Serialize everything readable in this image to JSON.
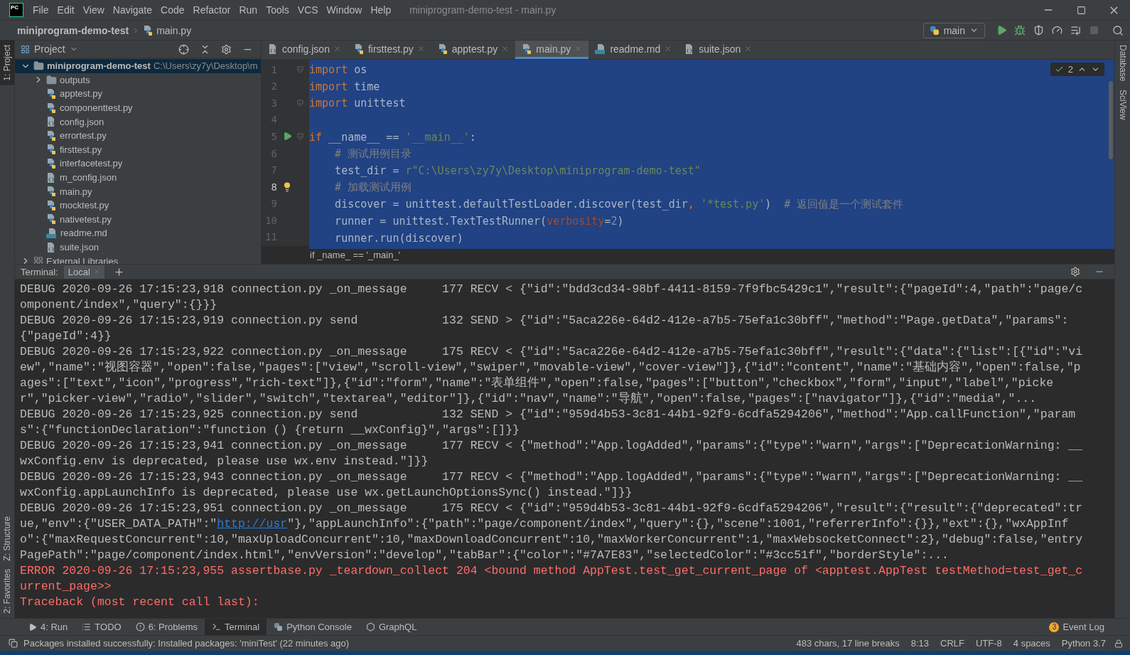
{
  "window": {
    "app_logo": "PC",
    "title": "miniprogram-demo-test - main.py"
  },
  "menu": [
    "File",
    "Edit",
    "View",
    "Navigate",
    "Code",
    "Refactor",
    "Run",
    "Tools",
    "VCS",
    "Window",
    "Help"
  ],
  "breadcrumb": [
    {
      "label": "miniprogram-demo-test",
      "kind": "project"
    },
    {
      "label": "main.py",
      "kind": "python"
    }
  ],
  "run_config": {
    "label": "main"
  },
  "left_stripe_top": [
    {
      "label": "1: Project",
      "selected": true
    }
  ],
  "left_stripe_bottom": [
    {
      "label": "Z: Structure",
      "selected": false
    },
    {
      "label": "2: Favorites",
      "selected": false
    }
  ],
  "right_stripe": [
    {
      "label": "Database"
    },
    {
      "label": "SciView"
    }
  ],
  "project": {
    "title": "Project",
    "root": {
      "label": "miniprogram-demo-test",
      "path": "C:\\Users\\zy7y\\Desktop\\m",
      "expanded": true,
      "children": [
        {
          "label": "outputs",
          "kind": "folder",
          "expanded": false
        },
        {
          "label": "apptest.py",
          "kind": "python"
        },
        {
          "label": "componenttest.py",
          "kind": "python"
        },
        {
          "label": "config.json",
          "kind": "json"
        },
        {
          "label": "errortest.py",
          "kind": "python"
        },
        {
          "label": "firsttest.py",
          "kind": "python"
        },
        {
          "label": "interfacetest.py",
          "kind": "python"
        },
        {
          "label": "m_config.json",
          "kind": "json"
        },
        {
          "label": "main.py",
          "kind": "python"
        },
        {
          "label": "mocktest.py",
          "kind": "python"
        },
        {
          "label": "nativetest.py",
          "kind": "python"
        },
        {
          "label": "readme.md",
          "kind": "markdown"
        },
        {
          "label": "suite.json",
          "kind": "json"
        }
      ]
    },
    "extra": {
      "label": "External Libraries",
      "kind": "library",
      "expanded": false
    }
  },
  "editor_tabs": [
    {
      "label": "config.json",
      "kind": "json",
      "selected": false
    },
    {
      "label": "firsttest.py",
      "kind": "python",
      "selected": false
    },
    {
      "label": "apptest.py",
      "kind": "python",
      "selected": false
    },
    {
      "label": "main.py",
      "kind": "python",
      "selected": true
    },
    {
      "label": "readme.md",
      "kind": "markdown",
      "selected": false
    },
    {
      "label": "suite.json",
      "kind": "json",
      "selected": false
    }
  ],
  "inspection": {
    "count": "2"
  },
  "code": [
    {
      "number": "1",
      "current": false,
      "fold": true,
      "tokens": [
        {
          "kind": "keyword",
          "text": "import"
        },
        {
          "kind": "plain",
          "text": " os"
        }
      ]
    },
    {
      "number": "2",
      "current": false,
      "fold": false,
      "tokens": [
        {
          "kind": "keyword",
          "text": "import"
        },
        {
          "kind": "plain",
          "text": " time"
        }
      ]
    },
    {
      "number": "3",
      "current": false,
      "fold": true,
      "tokens": [
        {
          "kind": "keyword",
          "text": "import"
        },
        {
          "kind": "plain",
          "text": " unittest"
        }
      ]
    },
    {
      "number": "4",
      "current": false,
      "fold": false
    },
    {
      "number": "5",
      "current": false,
      "fold": true,
      "kind": "run",
      "tokens": [
        {
          "kind": "keyword",
          "text": "if"
        },
        {
          "kind": "plain",
          "text": " __name__ == "
        },
        {
          "kind": "string",
          "text": "'__main__'"
        },
        {
          "kind": "plain",
          "text": ":"
        }
      ]
    },
    {
      "number": "6",
      "current": false,
      "fold": false,
      "tokens": [
        {
          "kind": "comment",
          "text": "    # 测试用例目录"
        }
      ]
    },
    {
      "number": "7",
      "current": false,
      "fold": false,
      "tokens": [
        {
          "kind": "plain",
          "text": "    test_dir = "
        },
        {
          "kind": "string",
          "text": "r\"C:\\Users\\zy7y\\Desktop\\miniprogram-demo-test\""
        }
      ]
    },
    {
      "number": "8",
      "current": true,
      "fold": false,
      "kind": "bulb",
      "tokens": [
        {
          "kind": "comment",
          "text": "    # 加载测试用例"
        }
      ]
    },
    {
      "number": "9",
      "current": false,
      "fold": false,
      "tokens": [
        {
          "kind": "plain",
          "text": "    discover = unittest.defaultTestLoader.discover(test_dir"
        },
        {
          "kind": "keyword",
          "text": ","
        },
        {
          "kind": "string",
          "text": " '*test.py'"
        },
        {
          "kind": "plain",
          "text": ")  "
        },
        {
          "kind": "comment",
          "text": "# 返回值是一个测试套件"
        }
      ]
    },
    {
      "number": "10",
      "current": false,
      "fold": false,
      "tokens": [
        {
          "kind": "plain",
          "text": "    runner = unittest.TextTestRunner("
        },
        {
          "kind": "param",
          "text": "verbosity"
        },
        {
          "kind": "plain",
          "text": "="
        },
        {
          "kind": "number",
          "text": "2"
        },
        {
          "kind": "plain",
          "text": ")"
        }
      ]
    },
    {
      "number": "11",
      "current": false,
      "fold": false,
      "tokens": [
        {
          "kind": "plain",
          "text": "    runner.run(discover)"
        }
      ]
    }
  ],
  "editor_breadcrumb": "if _name_ == '_main_'",
  "terminal": {
    "title": "Terminal:",
    "tabs": [
      {
        "label": "Local",
        "selected": true
      }
    ],
    "lines": [
      {
        "kind": "debug",
        "text": "DEBUG 2020-09-26 17:15:23,918 connection.py _on_message     177 RECV < {\"id\":\"bdd3cd34-98bf-4411-8159-7f9fbc5429c1\",\"result\":{\"pageId\":4,\"path\":\"page/component/index\",\"query\":{}}}"
      },
      {
        "kind": "debug",
        "text": "DEBUG 2020-09-26 17:15:23,919 connection.py send            132 SEND > {\"id\":\"5aca226e-64d2-412e-a7b5-75efa1c30bff\",\"method\":\"Page.getData\",\"params\":{\"pageId\":4}}"
      },
      {
        "kind": "debug",
        "text": "DEBUG 2020-09-26 17:15:23,922 connection.py _on_message     175 RECV < {\"id\":\"5aca226e-64d2-412e-a7b5-75efa1c30bff\",\"result\":{\"data\":{\"list\":[{\"id\":\"view\",\"name\":\"视图容器\",\"open\":false,\"pages\":[\"view\",\"scroll-view\",\"swiper\",\"movable-view\",\"cover-view\"]},{\"id\":\"content\",\"name\":\"基础内容\",\"open\":false,\"pages\":[\"text\",\"icon\",\"progress\",\"rich-text\"]},{\"id\":\"form\",\"name\":\"表单组件\",\"open\":false,\"pages\":[\"button\",\"checkbox\",\"form\",\"input\",\"label\",\"picker\",\"picker-view\",\"radio\",\"slider\",\"switch\",\"textarea\",\"editor\"]},{\"id\":\"nav\",\"name\":\"导航\",\"open\":false,\"pages\":[\"navigator\"]},{\"id\":\"media\",\"..."
      },
      {
        "kind": "debug",
        "text": "DEBUG 2020-09-26 17:15:23,925 connection.py send            132 SEND > {\"id\":\"959d4b53-3c81-44b1-92f9-6cdfa5294206\",\"method\":\"App.callFunction\",\"params\":{\"functionDeclaration\":\"function () {return __wxConfig}\",\"args\":[]}}"
      },
      {
        "kind": "debug",
        "text": "DEBUG 2020-09-26 17:15:23,941 connection.py _on_message     177 RECV < {\"method\":\"App.logAdded\",\"params\":{\"type\":\"warn\",\"args\":[\"DeprecationWarning: __wxConfig.env is deprecated, please use wx.env instead.\"]}}"
      },
      {
        "kind": "debug",
        "text": "DEBUG 2020-09-26 17:15:23,943 connection.py _on_message     177 RECV < {\"method\":\"App.logAdded\",\"params\":{\"type\":\"warn\",\"args\":[\"DeprecationWarning: __wxConfig.appLaunchInfo is deprecated, please use wx.getLaunchOptionsSync() instead.\"]}}"
      },
      {
        "kind": "debug",
        "text": "DEBUG 2020-09-26 17:15:23,951 connection.py _on_message     175 RECV < {\"id\":\"959d4b53-3c81-44b1-92f9-6cdfa5294206\",\"result\":{\"result\":{\"deprecated\":true,\"env\":{\"USER_DATA_PATH\":\"",
        "link": "http://usr",
        "text_after": "\"},\"appLaunchInfo\":{\"path\":\"page/component/index\",\"query\":{},\"scene\":1001,\"referrerInfo\":{}},\"ext\":{},\"wxAppInfo\":{\"maxRequestConcurrent\":10,\"maxUploadConcurrent\":10,\"maxDownloadConcurrent\":10,\"maxWorkerConcurrent\":1,\"maxWebsocketConnect\":2},\"debug\":false,\"entryPagePath\":\"page/component/index.html\",\"envVersion\":\"develop\",\"tabBar\":{\"color\":\"#7A7E83\",\"selectedColor\":\"#3cc51f\",\"borderStyle\":..."
      },
      {
        "kind": "error",
        "text": "ERROR 2020-09-26 17:15:23,955 assertbase.py _teardown_collect 204 <bound method AppTest.test_get_current_page of <apptest.AppTest testMethod=test_get_current_page>>"
      },
      {
        "kind": "error",
        "text": "Traceback (most recent call last):"
      }
    ]
  },
  "tool_tabs": [
    {
      "label": "4: Run",
      "kind": "run",
      "selected": false
    },
    {
      "label": "TODO",
      "kind": "todo",
      "selected": false
    },
    {
      "label": "6: Problems",
      "kind": "problems",
      "selected": false
    },
    {
      "label": "Terminal",
      "kind": "terminal",
      "selected": true
    },
    {
      "label": "Python Console",
      "kind": "console",
      "selected": false
    },
    {
      "label": "GraphQL",
      "kind": "graphql",
      "selected": false
    }
  ],
  "event_log": {
    "label": "Event Log",
    "badge": "3"
  },
  "status": {
    "message": "Packages installed successfully: Installed packages: 'miniTest' (22 minutes ago)",
    "items": [
      "483 chars, 17 line breaks",
      "8:13",
      "CRLF",
      "UTF-8",
      "4 spaces",
      "Python 3.7"
    ]
  }
}
